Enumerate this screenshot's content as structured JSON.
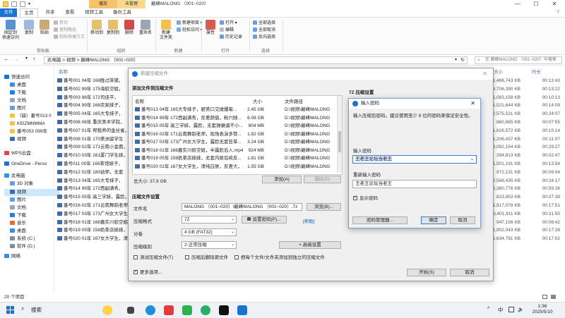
{
  "window": {
    "title": "巅峰MALONG （001~020）",
    "context_tab_1": "播放",
    "context_tab_2": "未管理",
    "minimize": "—",
    "maximize": "☐",
    "close": "✕"
  },
  "ribbon_tabs": [
    "文件",
    "主页",
    "共享",
    "查看",
    "视频工具",
    "备份工具"
  ],
  "ribbon": {
    "clipboard": {
      "pin": "固定到\n快速访问",
      "copy": "复制",
      "paste": "粘贴",
      "cut": "剪切",
      "copy_path": "复制路径",
      "paste_shortcut": "粘贴快捷方式",
      "group": "剪贴板"
    },
    "organize": {
      "move_to": "移动到",
      "copy_to": "复制到",
      "delete": "删除",
      "rename": "重命名",
      "group": "组织"
    },
    "new": {
      "new_folder": "新建\n文件夹",
      "new_item": "新建项目",
      "easy_access": "轻松访问",
      "group": "新建"
    },
    "open": {
      "properties": "属性",
      "open": "打开",
      "edit": "编辑",
      "history": "历史记录",
      "group": "打开"
    },
    "select": {
      "select_all": "全部选择",
      "select_none": "全部取消",
      "invert": "反向选择",
      "group": "选择"
    }
  },
  "address": {
    "path": "此电脑  >  视频  >  巅峰MALONG （001~020）",
    "search_placeholder": "在 巅峰MALONG （001~020）中搜索",
    "back": "←",
    "forward": "→",
    "up": "↑"
  },
  "nav": {
    "items": [
      {
        "label": "快速访问"
      },
      {
        "label": "桌面"
      },
      {
        "label": "下载"
      },
      {
        "label": "文档"
      },
      {
        "label": "图片"
      },
      {
        "label": "（缺）番号013 0"
      },
      {
        "label": "KEIZMNMMA"
      },
      {
        "label": "番号053 099年"
      },
      {
        "label": "视频"
      },
      {
        "label": "WPS云盘"
      },
      {
        "label": "OneDrive - Perso"
      },
      {
        "label": "此电脑"
      },
      {
        "label": "3D 对象"
      },
      {
        "label": "视频"
      },
      {
        "label": "图片"
      },
      {
        "label": "文档"
      },
      {
        "label": "下载"
      },
      {
        "label": "音乐"
      },
      {
        "label": "桌面"
      },
      {
        "label": "系统 (C:)"
      },
      {
        "label": "软件 (D:)"
      },
      {
        "label": "网络"
      }
    ]
  },
  "filelist": {
    "col_name": "名称",
    "col_size": "大小",
    "col_duration": "时长",
    "rows": [
      {
        "name": "番号001 04年 168胜过笨猪，",
        "size": "1,486,743 KB",
        "dur": "00:13:43"
      },
      {
        "name": "番号002 99年 175海航空姐，",
        "size": "3,706,390 KB",
        "dur": "00:13:22"
      },
      {
        "name": "番号003 98年 172司佳平，",
        "size": "1,083,158 KB",
        "dur": "00:10:13"
      },
      {
        "name": "番号004 99年 168农家妹子，",
        "size": "1,521,644 KB",
        "dur": "00:14:09"
      },
      {
        "name": "番号005 04年 165大专妹子，",
        "size": "2,575,531 KB",
        "dur": "00:24:07"
      },
      {
        "name": "番号006 06年 重庆美术学院，",
        "size": "860,885 KB",
        "dur": "00:07:55"
      },
      {
        "name": "番号007 01年 帮我养的金丝雀，",
        "size": "1,626,572 KB",
        "dur": "00:15:14"
      },
      {
        "name": "番号008 01年 170美洲留学生",
        "size": "1,206,437 KB",
        "dur": "00:11:07"
      },
      {
        "name": "番号009 02年 171云南小金鹿，",
        "size": "3,092,154 KB",
        "dur": "00:29:27"
      },
      {
        "name": "番号010 03年 161厦门学生妹，",
        "size": "294,813 KB",
        "dur": "00:02:47"
      },
      {
        "name": "番号011 00年 169茶馆妹子，",
        "size": "1,501,191 KB",
        "dur": "00:13:54"
      },
      {
        "name": "番号012 02年 180幼师，无套",
        "size": "972,131 KB",
        "dur": "00:09:04"
      },
      {
        "name": "番号013 04年 165大专妹子，",
        "size": "2,569,435 KB",
        "dur": "00:24:17"
      },
      {
        "name": "番号014 99年 172西副满秀，",
        "size": "6,380,776 KB",
        "dur": "00:59:26"
      },
      {
        "name": "番号015 05年 高三学妹，露脸，",
        "size": "823,853 KB",
        "dur": "00:07:39"
      },
      {
        "name": "番号016 02年 171云南舞蹈老师",
        "size": "1,917,078 KB",
        "dur": "00:17:51"
      },
      {
        "name": "番号017 03年 173广州女大学生，",
        "size": "3,401,911 KB",
        "dur": "00:31:55"
      },
      {
        "name": "番号018 01年 168嘉实川航空姐",
        "size": "947,156 KB",
        "dur": "00:08:42"
      },
      {
        "name": "番号019 05年 158奶茶店妹妹，",
        "size": "1,902,043 KB",
        "dur": "00:17:28"
      },
      {
        "name": "番号020 01年 167女大学生，清",
        "size": "1,634,781 KB",
        "dur": "00:17:02"
      }
    ]
  },
  "status": {
    "count": "20 个项目"
  },
  "taskbar": {
    "search": "搜索",
    "time": "1:36",
    "date": "2025/5/10",
    "lang": "中"
  },
  "dialog": {
    "title": "新建压缩文件",
    "add_section": "添加文件到压缩文件",
    "col_name": "名称",
    "col_size": "大小",
    "col_path": "文件路径",
    "files": [
      {
        "name": "番号013 04年 165大专妹子，厨美口交揉爆菊...",
        "size": "2.45 GB",
        "path": "D:\\视频\\巅峰MALONG"
      },
      {
        "name": "番号014 99年 172西副满秀，反差颜值，粉穴随...",
        "size": "6.08 GB",
        "path": "D:\\视频\\巅峰MALONG"
      },
      {
        "name": "番号015 05年 高三学妹，露脸，无套操嫩逼不小...",
        "size": "804 MB",
        "path": "D:\\视频\\巅峰MALONG"
      },
      {
        "name": "番号016 02年 171云南舞蹈老师，现场表演多赞...",
        "size": "1.82 GB",
        "path": "D:\\视频\\巅峰MALONG"
      },
      {
        "name": "番号017 03年 173广州女大学生，露脸无套狂草...",
        "size": "3.24 GB",
        "path": "D:\\视频\\巅峰MALONG"
      },
      {
        "name": "番号018 01年 168嘉实川航空姐，半露脸后入.mp4",
        "size": "924 MB",
        "path": "D:\\视频\\巅峰MALONG"
      },
      {
        "name": "番号019 05年 158奶茶店妹妹，无套内射后续反...",
        "size": "1.81 GB",
        "path": "D:\\视频\\巅峰MALONG"
      },
      {
        "name": "番号020 01年 167女大学生，清纯白肤，反差大，...",
        "size": "1.55 GB",
        "path": "D:\\视频\\巅峰MALONG"
      }
    ],
    "total": "总大小: 37.8 GB",
    "add_btn": "添加(A)",
    "delete_btn": "删除(D)",
    "settings_section": "压缩文件设置",
    "filename_label": "文件名",
    "filename_value": "MALONG （001~020）\\巅峰MALONG （001~020）.7z",
    "browse_btn": "浏览(B)...",
    "format_label": "压缩格式",
    "format_value": "7Z",
    "set_pwd_btn": "设置密码(P)...",
    "help_link": "[帮助]",
    "split_label": "分卷",
    "split_value": "4 GB (FAT32)",
    "level_label": "压缩级别",
    "level_value": "2-正常压缩",
    "advanced_btn": "+ 高级设置",
    "opt_test": "测试压缩文件(T)",
    "opt_delete": "压缩后删除源文件",
    "opt_separate": "把每个文件/文件夹添加到独立的压缩文件",
    "more_opts": "更多选项...",
    "start_btn": "开始(S)",
    "cancel_btn": "取消",
    "right_section": "7Z 压缩设置"
  },
  "password": {
    "title": "输入密码",
    "desc": "输入压缩包密码。建议使用至少 8 位的密码来保证安全性。",
    "label1": "输入密码",
    "value1": "王老王论坛当老王",
    "label2": "重新输入密码",
    "value2": "王老王论坛当老王",
    "show_pwd": "显示密码",
    "manager_btn": "密码管理器...",
    "ok_btn": "确定",
    "cancel_btn": "取消"
  }
}
